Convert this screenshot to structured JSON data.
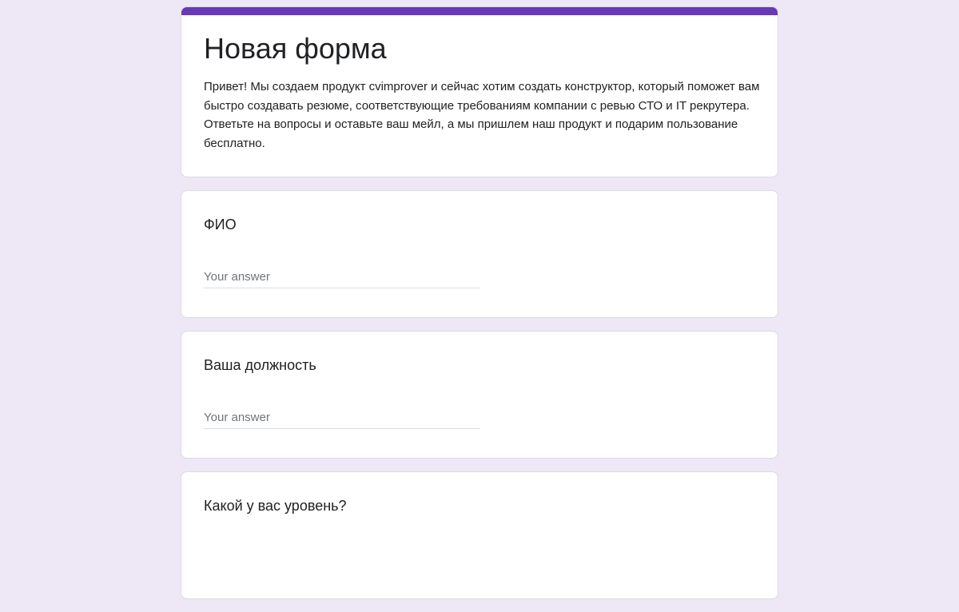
{
  "form": {
    "title": "Новая форма",
    "description": "Привет! Мы создаем продукт cvimprover и сейчас хотим создать конструктор, который поможет вам быстро создавать резюме, соответствующие требованиям компании с ревью СТО и IT рекрутера. Ответьте на вопросы и оставьте ваш мейл, а мы пришлем наш продукт и подарим пользование бесплатно.",
    "accent_color": "#673ab7",
    "background_color": "#ede7f6"
  },
  "questions": [
    {
      "title": "ФИО",
      "placeholder": "Your answer",
      "value": ""
    },
    {
      "title": "Ваша должность",
      "placeholder": "Your answer",
      "value": ""
    },
    {
      "title": "Какой у вас уровень?"
    }
  ]
}
